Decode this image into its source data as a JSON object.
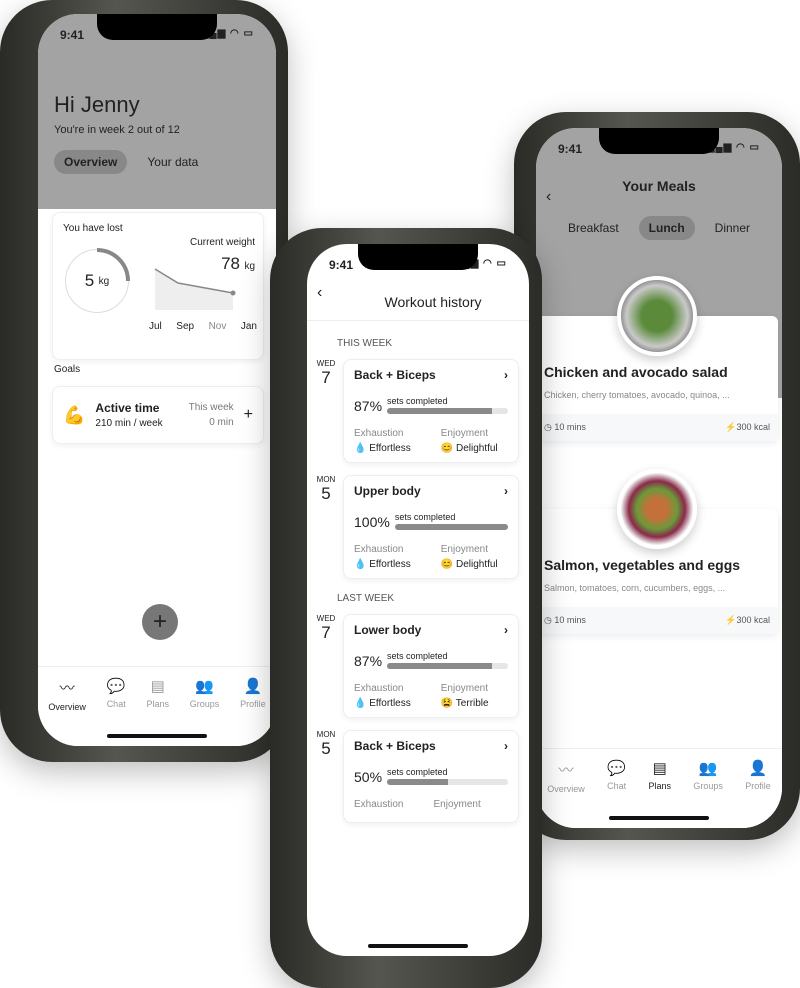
{
  "status_time": "9:41",
  "overview": {
    "greeting": "Hi Jenny",
    "subtitle": "You're in week 2 out of 12",
    "tabs": [
      {
        "label": "Overview",
        "active": true
      },
      {
        "label": "Your data",
        "active": false
      }
    ],
    "lost_label": "You have lost",
    "lost_value": "5",
    "lost_unit": "kg",
    "lost_progress_fraction": 0.2,
    "weight_label": "Current weight",
    "weight_value": "78",
    "weight_unit": "kg",
    "months": [
      "Jul",
      "Sep",
      "Nov",
      "Jan"
    ],
    "goals_label": "Goals",
    "goal": {
      "icon": "flexed-biceps-icon",
      "title": "Active time",
      "target": "210 min / week",
      "week_label": "This week",
      "week_value": "0 min"
    },
    "fab_icon": "plus-icon",
    "nav": [
      {
        "label": "Overview",
        "icon": "activity-icon",
        "active": true
      },
      {
        "label": "Chat",
        "icon": "chat-icon"
      },
      {
        "label": "Plans",
        "icon": "document-icon"
      },
      {
        "label": "Groups",
        "icon": "groups-icon"
      },
      {
        "label": "Profile",
        "icon": "profile-icon"
      }
    ]
  },
  "workout": {
    "title": "Workout history",
    "sections": [
      {
        "label": "THIS WEEK",
        "items": [
          {
            "day": "WED",
            "date": "7",
            "name": "Back + Biceps",
            "pct": "87%",
            "progress": 87,
            "sets": "sets completed",
            "exh_label": "Exhaustion",
            "exh": "Effortless",
            "enj_label": "Enjoyment",
            "enj": "Delightful",
            "enj_icon": "😊"
          },
          {
            "day": "MON",
            "date": "5",
            "name": "Upper body",
            "pct": "100%",
            "progress": 100,
            "sets": "sets completed",
            "exh_label": "Exhaustion",
            "exh": "Effortless",
            "enj_label": "Enjoyment",
            "enj": "Delightful",
            "enj_icon": "😊"
          }
        ]
      },
      {
        "label": "LAST WEEK",
        "items": [
          {
            "day": "WED",
            "date": "7",
            "name": "Lower body",
            "pct": "87%",
            "progress": 87,
            "sets": "sets completed",
            "exh_label": "Exhaustion",
            "exh": "Effortless",
            "enj_label": "Enjoyment",
            "enj": "Terrible",
            "enj_icon": "😫"
          },
          {
            "day": "MON",
            "date": "5",
            "name": "Back + Biceps",
            "pct": "50%",
            "progress": 50,
            "sets": "sets completed",
            "exh_label": "Exhaustion",
            "exh": "",
            "enj_label": "Enjoyment",
            "enj": "",
            "enj_icon": ""
          }
        ]
      }
    ]
  },
  "meals": {
    "title": "Your Meals",
    "tabs": [
      {
        "label": "Breakfast"
      },
      {
        "label": "Lunch",
        "active": true
      },
      {
        "label": "Dinner"
      }
    ],
    "items": [
      {
        "name": "Chicken and avocado salad",
        "desc": "Chicken, cherry tomatoes, avocado, quinoa, ...",
        "time": "10 mins",
        "kcal": "300 kcal"
      },
      {
        "name": "Salmon, vegetables and eggs",
        "desc": "Salmon, tomatoes, corn, cucumbers, eggs, ...",
        "time": "10 mins",
        "kcal": "300 kcal"
      }
    ],
    "nav": [
      {
        "label": "Overview",
        "icon": "activity-icon"
      },
      {
        "label": "Chat",
        "icon": "chat-icon"
      },
      {
        "label": "Plans",
        "icon": "document-icon",
        "active": true
      },
      {
        "label": "Groups",
        "icon": "groups-icon"
      },
      {
        "label": "Profile",
        "icon": "profile-icon"
      }
    ]
  }
}
